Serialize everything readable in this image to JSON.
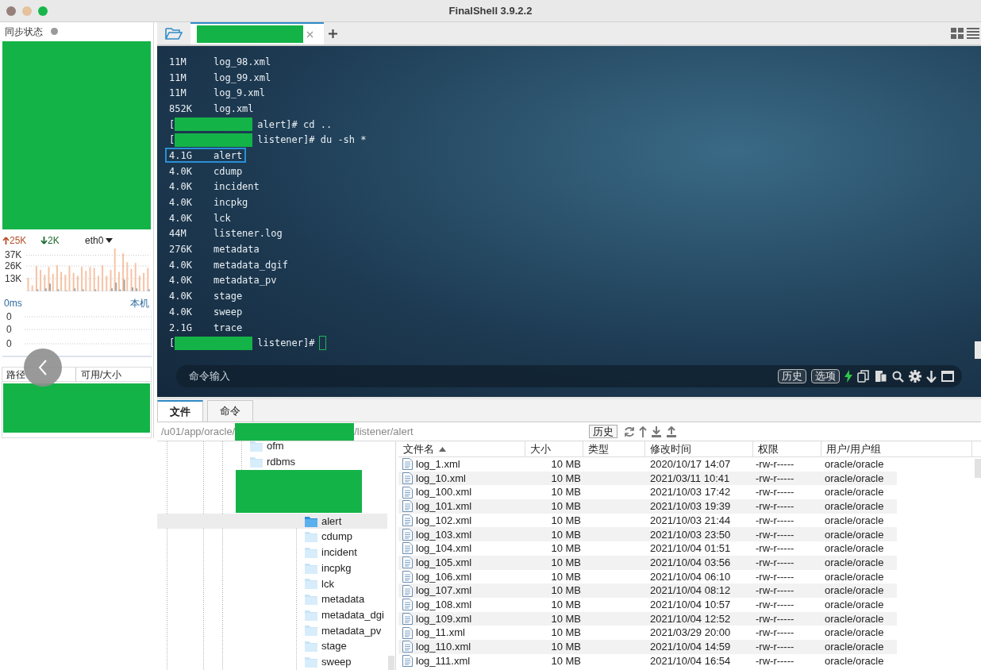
{
  "window": {
    "title": "FinalShell 3.9.2.2"
  },
  "sidebar": {
    "sync_label": "同步状态",
    "upload": "25K",
    "download": "2K",
    "interface": "eth0",
    "net_ticks": [
      "37K",
      "26K",
      "13K"
    ],
    "latency": "0ms",
    "host": "本机",
    "latency_ticks": [
      "0",
      "0",
      "0"
    ],
    "disk_columns": [
      "路径",
      "可用/大小"
    ]
  },
  "tabs": [
    {
      "selected": true
    }
  ],
  "terminal": {
    "lines": [
      {
        "kind": "output",
        "size": "11M",
        "name": "log_98.xml",
        "highlighted": false
      },
      {
        "kind": "output",
        "size": "11M",
        "name": "log_99.xml",
        "highlighted": false
      },
      {
        "kind": "output",
        "size": "11M",
        "name": "log_9.xml",
        "highlighted": false
      },
      {
        "kind": "output",
        "size": "852K",
        "name": "log.xml",
        "highlighted": false
      },
      {
        "kind": "prompt",
        "open": "[",
        "text": "alert]# cd ..",
        "cursor": false
      },
      {
        "kind": "prompt",
        "open": "[",
        "text": "listener]# du -sh *",
        "cursor": false
      },
      {
        "kind": "output",
        "size": "4.1G",
        "name": "alert",
        "highlighted": true
      },
      {
        "kind": "output",
        "size": "4.0K",
        "name": "cdump",
        "highlighted": false
      },
      {
        "kind": "output",
        "size": "4.0K",
        "name": "incident",
        "highlighted": false
      },
      {
        "kind": "output",
        "size": "4.0K",
        "name": "incpkg",
        "highlighted": false
      },
      {
        "kind": "output",
        "size": "4.0K",
        "name": "lck",
        "highlighted": false
      },
      {
        "kind": "output",
        "size": "44M",
        "name": "listener.log",
        "highlighted": false
      },
      {
        "kind": "output",
        "size": "276K",
        "name": "metadata",
        "highlighted": false
      },
      {
        "kind": "output",
        "size": "4.0K",
        "name": "metadata_dgif",
        "highlighted": false
      },
      {
        "kind": "output",
        "size": "4.0K",
        "name": "metadata_pv",
        "highlighted": false
      },
      {
        "kind": "output",
        "size": "4.0K",
        "name": "stage",
        "highlighted": false
      },
      {
        "kind": "output",
        "size": "4.0K",
        "name": "sweep",
        "highlighted": false
      },
      {
        "kind": "output",
        "size": "2.1G",
        "name": "trace",
        "highlighted": false
      },
      {
        "kind": "prompt",
        "open": "[",
        "text": "listener]#",
        "cursor": true
      }
    ],
    "command_placeholder": "命令输入",
    "buttons": [
      "历史",
      "选项"
    ]
  },
  "bottom_tabs": [
    {
      "label": "文件",
      "selected": true
    },
    {
      "label": "命令",
      "selected": false
    }
  ],
  "path_bar": {
    "path_start": "/u01/app/oracle/",
    "path_end": "/listener/alert",
    "history_button": "历史"
  },
  "tree": {
    "upper_items": [
      {
        "label": "ofm",
        "selected": false
      },
      {
        "label": "rdbms",
        "selected": false
      }
    ],
    "lower_items": [
      {
        "label": "alert",
        "selected": true
      },
      {
        "label": "cdump",
        "selected": false
      },
      {
        "label": "incident",
        "selected": false
      },
      {
        "label": "incpkg",
        "selected": false
      },
      {
        "label": "lck",
        "selected": false
      },
      {
        "label": "metadata",
        "selected": false
      },
      {
        "label": "metadata_dgi",
        "selected": false
      },
      {
        "label": "metadata_pv",
        "selected": false
      },
      {
        "label": "stage",
        "selected": false
      },
      {
        "label": "sweep",
        "selected": false
      }
    ]
  },
  "table": {
    "columns": [
      {
        "label": "文件名",
        "sorted": true
      },
      {
        "label": "大小",
        "sorted": false
      },
      {
        "label": "类型",
        "sorted": false
      },
      {
        "label": "修改时间",
        "sorted": false
      },
      {
        "label": "权限",
        "sorted": false
      },
      {
        "label": "用户/用户组",
        "sorted": false
      }
    ],
    "rows": [
      [
        "log_1.xml",
        "10 MB",
        "",
        "2020/10/17 14:07",
        "-rw-r-----",
        "oracle/oracle"
      ],
      [
        "log_10.xml",
        "10 MB",
        "",
        "2021/03/11 10:41",
        "-rw-r-----",
        "oracle/oracle"
      ],
      [
        "log_100.xml",
        "10 MB",
        "",
        "2021/10/03 17:42",
        "-rw-r-----",
        "oracle/oracle"
      ],
      [
        "log_101.xml",
        "10 MB",
        "",
        "2021/10/03 19:39",
        "-rw-r-----",
        "oracle/oracle"
      ],
      [
        "log_102.xml",
        "10 MB",
        "",
        "2021/10/03 21:44",
        "-rw-r-----",
        "oracle/oracle"
      ],
      [
        "log_103.xml",
        "10 MB",
        "",
        "2021/10/03 23:50",
        "-rw-r-----",
        "oracle/oracle"
      ],
      [
        "log_104.xml",
        "10 MB",
        "",
        "2021/10/04 01:51",
        "-rw-r-----",
        "oracle/oracle"
      ],
      [
        "log_105.xml",
        "10 MB",
        "",
        "2021/10/04 03:56",
        "-rw-r-----",
        "oracle/oracle"
      ],
      [
        "log_106.xml",
        "10 MB",
        "",
        "2021/10/04 06:10",
        "-rw-r-----",
        "oracle/oracle"
      ],
      [
        "log_107.xml",
        "10 MB",
        "",
        "2021/10/04 08:12",
        "-rw-r-----",
        "oracle/oracle"
      ],
      [
        "log_108.xml",
        "10 MB",
        "",
        "2021/10/04 10:57",
        "-rw-r-----",
        "oracle/oracle"
      ],
      [
        "log_109.xml",
        "10 MB",
        "",
        "2021/10/04 12:52",
        "-rw-r-----",
        "oracle/oracle"
      ],
      [
        "log_11.xml",
        "10 MB",
        "",
        "2021/03/29 20:00",
        "-rw-r-----",
        "oracle/oracle"
      ],
      [
        "log_110.xml",
        "10 MB",
        "",
        "2021/10/04 14:59",
        "-rw-r-----",
        "oracle/oracle"
      ],
      [
        "log_111.xml",
        "10 MB",
        "",
        "2021/10/04 16:54",
        "-rw-r-----",
        "oracle/oracle"
      ]
    ]
  }
}
